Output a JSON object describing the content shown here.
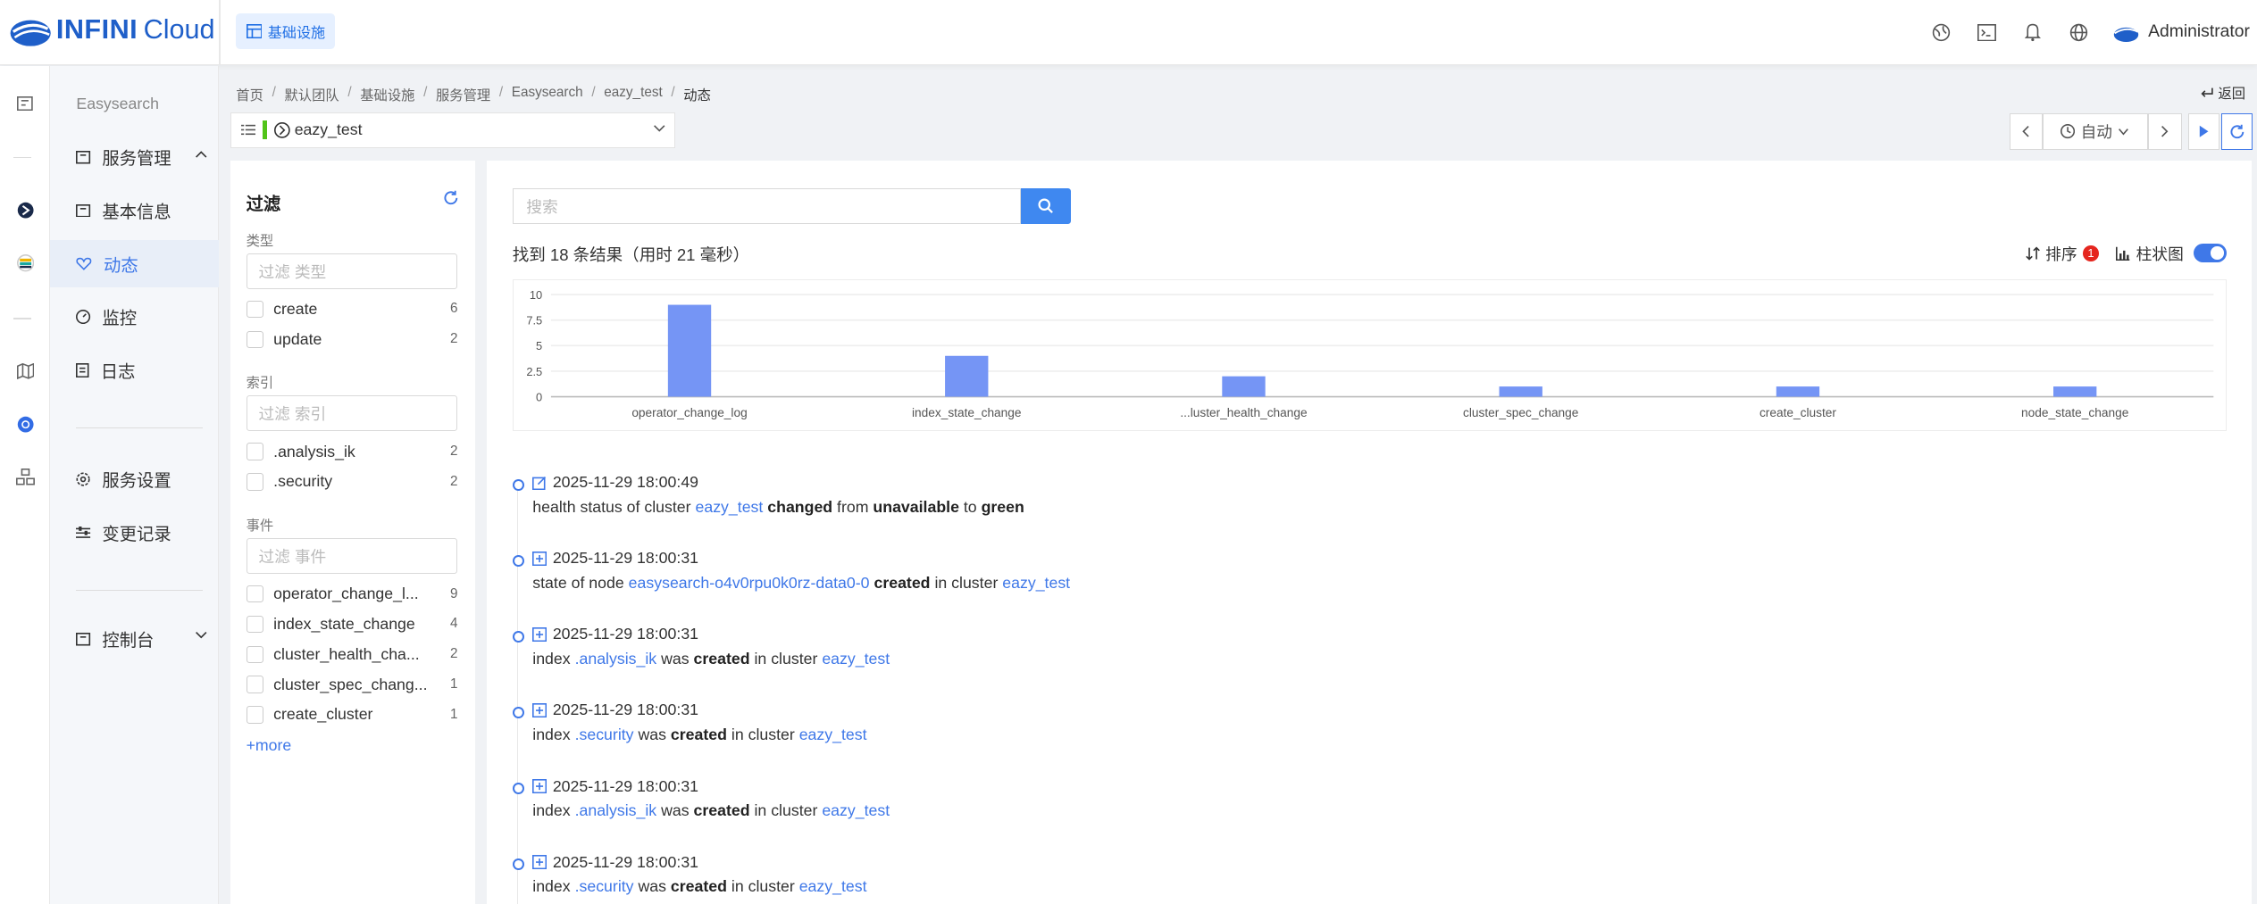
{
  "app": {
    "logo_bold": "INFINI",
    "logo_rest": "Cloud",
    "infra_button": "基础设施",
    "user_name": "Administrator"
  },
  "menu": {
    "title": "Easysearch",
    "items": [
      {
        "label": "服务管理"
      },
      {
        "label": "基本信息"
      },
      {
        "label": "动态"
      },
      {
        "label": "监控"
      },
      {
        "label": "日志"
      },
      {
        "label": "服务设置"
      },
      {
        "label": "变更记录"
      },
      {
        "label": "控制台"
      }
    ]
  },
  "breadcrumb": [
    "首页",
    "默认团队",
    "基础设施",
    "服务管理",
    "Easysearch",
    "eazy_test",
    "动态"
  ],
  "back_label": "返回",
  "cluster_select": {
    "value": "eazy_test"
  },
  "time": {
    "mode": "自动"
  },
  "filter": {
    "title": "过滤",
    "type_label": "类型",
    "type_placeholder": "过滤 类型",
    "types": [
      {
        "name": "create",
        "count": "6"
      },
      {
        "name": "update",
        "count": "2"
      }
    ],
    "index_label": "索引",
    "index_placeholder": "过滤 索引",
    "indices": [
      {
        "name": ".analysis_ik",
        "count": "2"
      },
      {
        "name": ".security",
        "count": "2"
      }
    ],
    "event_label": "事件",
    "event_placeholder": "过滤 事件",
    "events": [
      {
        "name": "operator_change_l...",
        "count": "9"
      },
      {
        "name": "index_state_change",
        "count": "4"
      },
      {
        "name": "cluster_health_cha...",
        "count": "2"
      },
      {
        "name": "cluster_spec_chang...",
        "count": "1"
      },
      {
        "name": "create_cluster",
        "count": "1"
      }
    ],
    "more": "more"
  },
  "search": {
    "placeholder": "搜索"
  },
  "results_text": "找到 18 条结果（用时 21 毫秒）",
  "sort_label": "排序",
  "sort_badge": "1",
  "chart_toggle_label": "柱状图",
  "chart_data": {
    "type": "bar",
    "categories": [
      "operator_change_log",
      "index_state_change",
      "...luster_health_change",
      "cluster_spec_change",
      "create_cluster",
      "node_state_change"
    ],
    "values": [
      9,
      4,
      2,
      1,
      1,
      1
    ],
    "ylim": [
      0,
      10
    ],
    "yticks": [
      "10",
      "7.5",
      "5",
      "2.5",
      "0"
    ],
    "bar_color": "#7595f5"
  },
  "timeline": [
    {
      "time": "2025-11-29 18:00:49",
      "icon": "edit-icon",
      "parts": [
        [
          "t",
          "health status of cluster "
        ],
        [
          "l",
          "eazy_test"
        ],
        [
          "t",
          " "
        ],
        [
          "b",
          "changed"
        ],
        [
          "t",
          " from "
        ],
        [
          "b",
          "unavailable"
        ],
        [
          "t",
          " to "
        ],
        [
          "b",
          "green"
        ]
      ]
    },
    {
      "time": "2025-11-29 18:00:31",
      "icon": "plus-square-icon",
      "parts": [
        [
          "t",
          "state of node "
        ],
        [
          "l",
          "easysearch-o4v0rpu0k0rz-data0-0"
        ],
        [
          "t",
          " "
        ],
        [
          "b",
          "created"
        ],
        [
          "t",
          " in cluster "
        ],
        [
          "l",
          "eazy_test"
        ]
      ]
    },
    {
      "time": "2025-11-29 18:00:31",
      "icon": "plus-square-icon",
      "parts": [
        [
          "t",
          "index "
        ],
        [
          "l",
          ".analysis_ik"
        ],
        [
          "t",
          " was "
        ],
        [
          "b",
          "created"
        ],
        [
          "t",
          " in cluster "
        ],
        [
          "l",
          "eazy_test"
        ]
      ]
    },
    {
      "time": "2025-11-29 18:00:31",
      "icon": "plus-square-icon",
      "parts": [
        [
          "t",
          "index "
        ],
        [
          "l",
          ".security"
        ],
        [
          "t",
          " was "
        ],
        [
          "b",
          "created"
        ],
        [
          "t",
          " in cluster "
        ],
        [
          "l",
          "eazy_test"
        ]
      ]
    },
    {
      "time": "2025-11-29 18:00:31",
      "icon": "plus-square-icon",
      "parts": [
        [
          "t",
          "index "
        ],
        [
          "l",
          ".analysis_ik"
        ],
        [
          "t",
          " was "
        ],
        [
          "b",
          "created"
        ],
        [
          "t",
          " in cluster "
        ],
        [
          "l",
          "eazy_test"
        ]
      ]
    },
    {
      "time": "2025-11-29 18:00:31",
      "icon": "plus-square-icon",
      "parts": [
        [
          "t",
          "index "
        ],
        [
          "l",
          ".security"
        ],
        [
          "t",
          " was "
        ],
        [
          "b",
          "created"
        ],
        [
          "t",
          " in cluster "
        ],
        [
          "l",
          "eazy_test"
        ]
      ]
    }
  ]
}
